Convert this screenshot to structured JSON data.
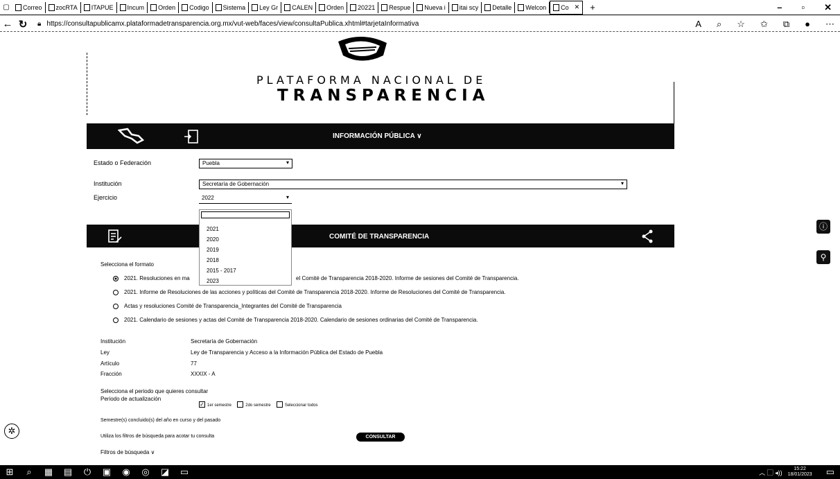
{
  "tabs": [
    {
      "label": "Correo"
    },
    {
      "label": "zocRTA"
    },
    {
      "label": "ITAPUE"
    },
    {
      "label": "Incum"
    },
    {
      "label": "Orden"
    },
    {
      "label": "Codigo"
    },
    {
      "label": "Sistema"
    },
    {
      "label": "Ley Gr"
    },
    {
      "label": "CALEN"
    },
    {
      "label": "Orden"
    },
    {
      "label": "20221"
    },
    {
      "label": "Respue"
    },
    {
      "label": "Nueva i"
    },
    {
      "label": "itai scy"
    },
    {
      "label": "Detalle"
    },
    {
      "label": "Welcon"
    },
    {
      "label": "Co"
    }
  ],
  "address": {
    "url": "https://consultapublicamx.plataformadetransparencia.org.mx/vut-web/faces/view/consultaPublica.xhtml#tarjetaInformativa"
  },
  "brand": {
    "line1": "PLATAFORMA NACIONAL DE",
    "line2": "TRANSPARENCIA"
  },
  "nav_bar": {
    "title": "INFORMACIÓN PÚBLICA ∨"
  },
  "filters": {
    "estado_label": "Estado o Federación",
    "estado_value": "Puebla",
    "institucion_label": "Institución",
    "institucion_value": "Secretaría de Gobernación",
    "ejercicio_label": "Ejercicio",
    "ejercicio_value": "2022"
  },
  "dropdown": {
    "options": [
      "2021",
      "2020",
      "2019",
      "2018",
      "2015 - 2017",
      "2023"
    ]
  },
  "committee_bar": {
    "title": "COMITÉ DE TRANSPARENCIA"
  },
  "formats": {
    "title": "Selecciona el formato",
    "items": [
      {
        "label": "2021. Resoluciones en ma",
        "label2": "el Comité de Transparencia 2018-2020. Informe de sesiones del Comité de Transparencia.",
        "selected": true
      },
      {
        "label": "2021. Informe de Resoluciones de las acciones y políticas del Comité de Transparencia 2018-2020. Informe de Resoluciones del Comité de Transparencia.",
        "selected": false
      },
      {
        "label": "Actas y resoluciones Comité de Transparencia_Integrantes del Comité de Transparencia",
        "selected": false
      },
      {
        "label": "2021. Calendario de sesiones y actas del Comité de Transparencia 2018-2020. Calendario de sesiones ordinarias del Comité de Transparencia.",
        "selected": false
      }
    ]
  },
  "info": {
    "institucion_label": "Institución",
    "institucion_value": "Secretaría de Gobernación",
    "ley_label": "Ley",
    "ley_value": "Ley de Transparencia y Acceso a la Información Pública del Estado de Puebla",
    "articulo_label": "Artículo",
    "articulo_value": "77",
    "fraccion_label": "Fracción",
    "fraccion_value": "XXXIX - A"
  },
  "period": {
    "prompt": "Selecciona el periodo que quieres consultar",
    "label": "Periodo de actualización",
    "opt1": "1er semestre",
    "opt2": "2do semestre",
    "opt3": "Seleccionar todos",
    "opt1_checked": true
  },
  "notes": {
    "semestre": "Semestre(s) concluido(s) del año en curso y del pasado",
    "filtros": "Utiliza los filtros de búsqueda para acotar tu consulta",
    "filtros_toggle": "Filtros de búsqueda ∨"
  },
  "buttons": {
    "consultar": "CONSULTAR"
  },
  "taskbar": {
    "time": "15:22",
    "date": "18/01/2023"
  }
}
